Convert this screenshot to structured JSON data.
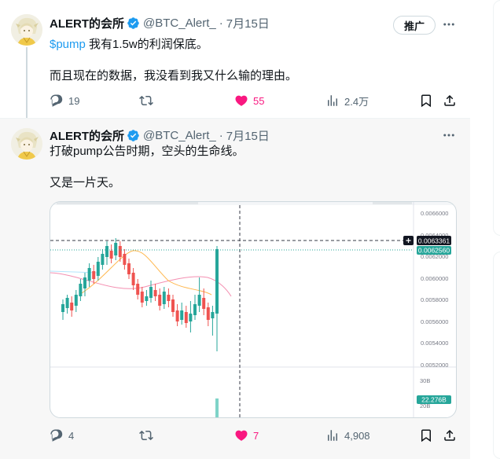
{
  "tweets": [
    {
      "name": "ALERT的会所",
      "handle": "@BTC_Alert_",
      "dot": "·",
      "date": "7月15日",
      "promote": "推广",
      "cashtag": "$pump",
      "line1": " 我有1.5w的利润保底。",
      "line2": "而且现在的数据，我没看到我又什么输的理由。",
      "replies": "19",
      "likes": "55",
      "views": "2.4万"
    },
    {
      "name": "ALERT的会所",
      "handle": "@BTC_Alert_",
      "dot": "·",
      "date": "7月15日",
      "line1": "打破pump公告时期，空头的生命线。",
      "line2": "又是一片天。",
      "replies": "4",
      "likes": "7",
      "views": "4,908"
    }
  ],
  "chart": {
    "price_ticks": [
      "0.0066000",
      "0.0064000",
      "0.0062000",
      "0.0060000",
      "0.0058000",
      "0.0056000",
      "0.0054000",
      "0.0052000"
    ],
    "crosshair_label": "0.0063361",
    "last_price_label": "0.0062560",
    "volume_ticks": [
      "30B",
      "20B"
    ],
    "volume_label": "22.276B",
    "colors": {
      "up": "#26a69a",
      "down": "#ef5350",
      "crosshair_tag": "#131722",
      "price_tag": "#26a69a"
    }
  },
  "icons": {
    "verified": "verified-badge-icon",
    "reply": "reply-icon",
    "retweet": "retweet-icon",
    "like": "heart-icon",
    "views": "views-icon",
    "bookmark": "bookmark-icon",
    "share": "share-icon",
    "more": "more-icon"
  },
  "colors": {
    "accent": "#1d9bf0",
    "like": "#f91880",
    "muted": "#536471"
  }
}
